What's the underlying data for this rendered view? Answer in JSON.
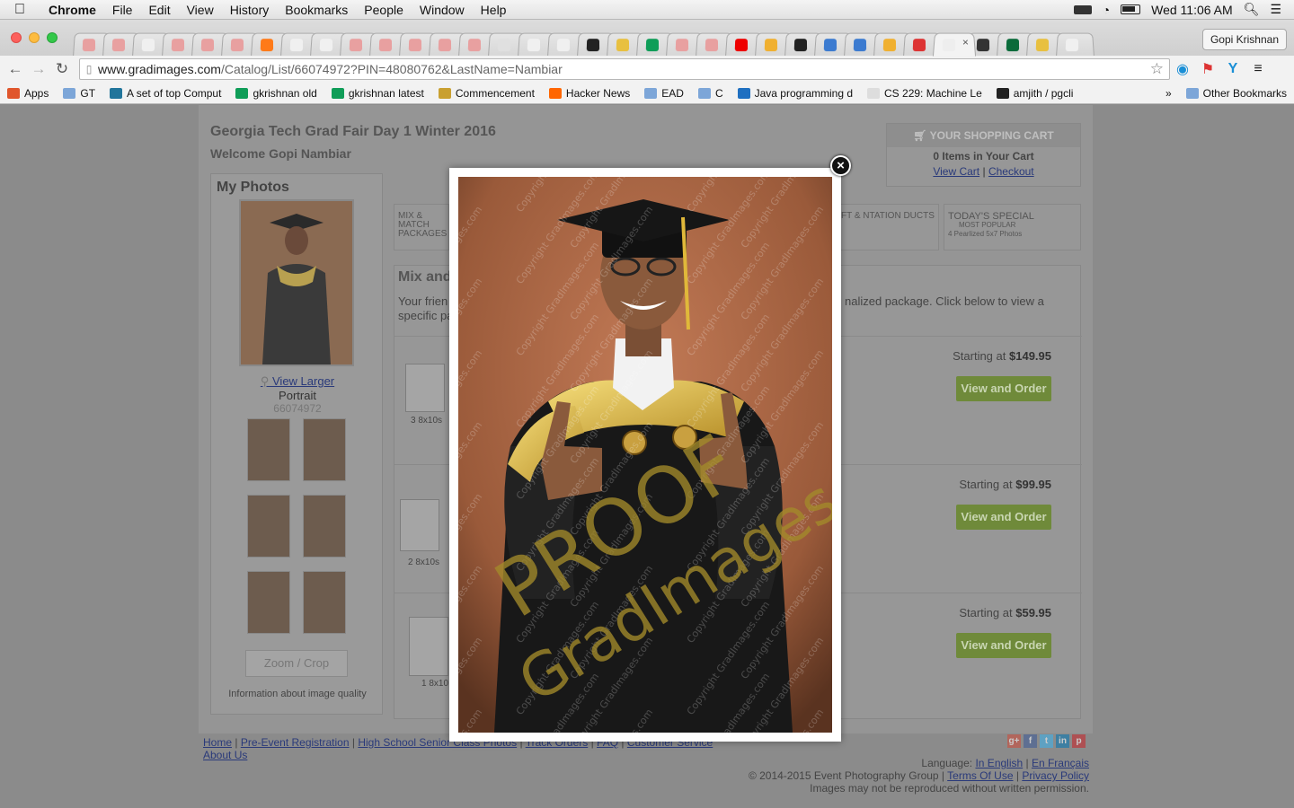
{
  "menubar": {
    "app": "Chrome",
    "items": [
      "File",
      "Edit",
      "View",
      "History",
      "Bookmarks",
      "People",
      "Window",
      "Help"
    ],
    "clock": "Wed 11:06 AM"
  },
  "tabstrip": {
    "tab_count": 34,
    "profile": "Gopi Krishnan"
  },
  "toolbar": {
    "url_host": "www.gradimages.com",
    "url_path": "/Catalog/List/66074972?PIN=48080762&LastName=Nambiar"
  },
  "bookmarks": {
    "items": [
      {
        "label": "Apps",
        "icon": "apps-grid-icon"
      },
      {
        "label": "GT",
        "icon": "folder-icon"
      },
      {
        "label": "A set of top Comput",
        "icon": "wordpress-icon"
      },
      {
        "label": "gkrishnan old",
        "icon": "sheets-icon"
      },
      {
        "label": "gkrishnan latest",
        "icon": "sheets-icon"
      },
      {
        "label": "Commencement",
        "icon": "buzz-icon"
      },
      {
        "label": "Hacker News",
        "icon": "hn-icon"
      },
      {
        "label": "EAD",
        "icon": "folder-icon"
      },
      {
        "label": "C",
        "icon": "folder-icon"
      },
      {
        "label": "Java programming d",
        "icon": "ibm-icon"
      },
      {
        "label": "CS 229: Machine Le",
        "icon": "page-icon"
      },
      {
        "label": "amjith / pgcli",
        "icon": "github-icon"
      }
    ],
    "overflow": "»",
    "other": "Other Bookmarks"
  },
  "site": {
    "event_title": "Georgia Tech Grad Fair Day 1 Winter 2016",
    "welcome": "Welcome Gopi Nambiar",
    "my_photos": "My Photos",
    "view_larger": "View Larger",
    "portrait": "Portrait",
    "photo_id": "66074972",
    "zoom_crop": "Zoom / Crop",
    "quality": "Information about image quality",
    "cart": {
      "header": "YOUR SHOPPING CART",
      "count": "0 Items in Your Cart",
      "view_cart": "View Cart",
      "checkout": "Checkout"
    },
    "tabs": {
      "mix": "MIX & MATCH PACKAGES",
      "gift": "FT & NTATION DUCTS",
      "special_title": "TODAY'S SPECIAL",
      "special_sub1": "MOST POPULAR",
      "special_sub2": "4 Pearlized 5x7 Photos"
    },
    "mix_heading": "Mix and",
    "mix_desc_left": "Your frien",
    "mix_desc_left2": "specific pa",
    "mix_desc_right": "nalized package. Click below to view a",
    "packages": [
      {
        "caption": "3 8x10s",
        "price_label": "Starting at",
        "price": "$149.95",
        "button": "View and Order"
      },
      {
        "caption": "2 8x10s",
        "price_label": "Starting at",
        "price": "$99.95",
        "button": "View and Order"
      },
      {
        "caption": "1 8x10",
        "price_label": "Starting at",
        "price": "$59.95",
        "button": "View and Order"
      }
    ],
    "footer": {
      "links": [
        "Home",
        "Pre-Event Registration",
        "High School Senior Class Photos",
        "Track Orders",
        "FAQ",
        "Customer Service"
      ],
      "about": "About Us",
      "language_label": "Language:",
      "lang_en": "In English",
      "lang_fr": "En Français",
      "copyright": "© 2014-2015 Event Photography Group |",
      "terms": "Terms Of Use",
      "privacy": "Privacy Policy",
      "notice": "Images may not be reproduced without written permission."
    }
  },
  "lightbox": {
    "watermark_main": "PROOF",
    "watermark_sub": "GradImages",
    "watermark_repeat": "Copyright GradImages.com",
    "close": "×"
  },
  "colors": {
    "overlay_bg": "#8b8b8b",
    "button_green": "#6f8a3a",
    "link": "#2a3a7a",
    "photo_bg": "#a2603f",
    "watermark": "#a38a2a"
  }
}
